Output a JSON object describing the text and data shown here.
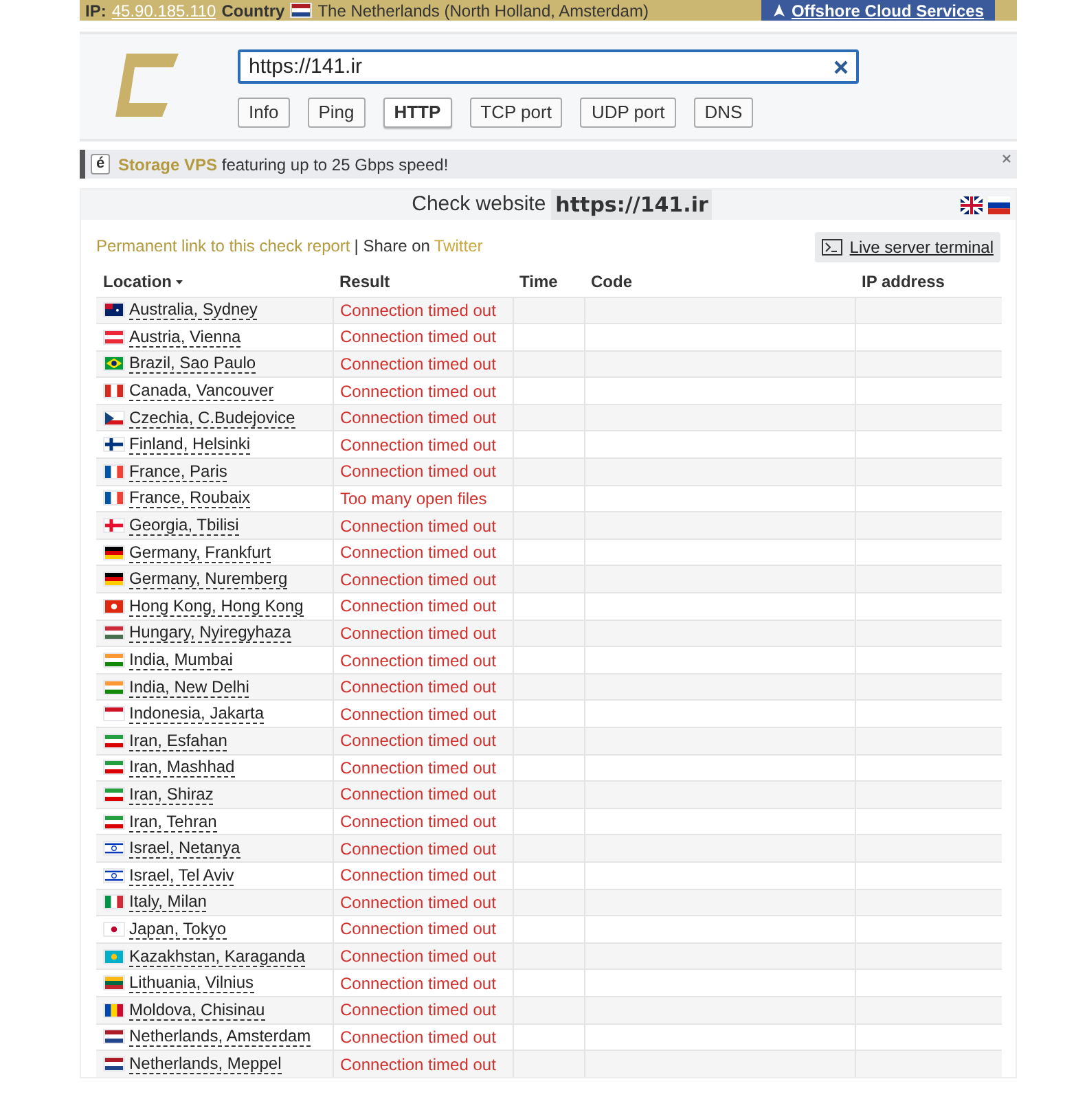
{
  "top_bar": {
    "ip_label": "IP:",
    "ip": "45.90.185.110",
    "country_label": "Country",
    "country_flag": {
      "kind": "nl"
    },
    "country": "The Netherlands (North Holland, Amsterdam)",
    "promo": "Offshore Cloud Services"
  },
  "search": {
    "value": "https://141.ir"
  },
  "tabs": [
    {
      "label": "Info",
      "selected": false
    },
    {
      "label": "Ping",
      "selected": false
    },
    {
      "label": "HTTP",
      "selected": true
    },
    {
      "label": "TCP port",
      "selected": false
    },
    {
      "label": "UDP port",
      "selected": false
    },
    {
      "label": "DNS",
      "selected": false
    }
  ],
  "banner": {
    "icon_letter": "é",
    "highlight": "Storage VPS",
    "text": "featuring up to 25 Gbps speed!"
  },
  "panel": {
    "title": "Check website",
    "target": "https://141.ir",
    "permalink": "Permanent link to this check report",
    "share_prefix": "| Share on",
    "share_link": "Twitter",
    "terminal_button": "Live server terminal"
  },
  "table": {
    "columns": [
      "Location",
      "Result",
      "Time",
      "Code",
      "IP address"
    ],
    "rows": [
      {
        "kind": "au",
        "location": "Australia, Sydney",
        "result": "Connection timed out"
      },
      {
        "kind": "at",
        "location": "Austria, Vienna",
        "result": "Connection timed out"
      },
      {
        "kind": "br",
        "location": "Brazil, Sao Paulo",
        "result": "Connection timed out"
      },
      {
        "kind": "ca",
        "location": "Canada, Vancouver",
        "result": "Connection timed out"
      },
      {
        "kind": "cz",
        "location": "Czechia, C.Budejovice",
        "result": "Connection timed out"
      },
      {
        "kind": "fi",
        "location": "Finland, Helsinki",
        "result": "Connection timed out"
      },
      {
        "kind": "fr",
        "location": "France, Paris",
        "result": "Connection timed out"
      },
      {
        "kind": "fr",
        "location": "France, Roubaix",
        "result": "Too many open files"
      },
      {
        "kind": "ge",
        "location": "Georgia, Tbilisi",
        "result": "Connection timed out"
      },
      {
        "kind": "de",
        "location": "Germany, Frankfurt",
        "result": "Connection timed out"
      },
      {
        "kind": "de",
        "location": "Germany, Nuremberg",
        "result": "Connection timed out"
      },
      {
        "kind": "hk",
        "location": "Hong Kong, Hong Kong",
        "result": "Connection timed out"
      },
      {
        "kind": "hu",
        "location": "Hungary, Nyiregyhaza",
        "result": "Connection timed out"
      },
      {
        "kind": "in",
        "location": "India, Mumbai",
        "result": "Connection timed out"
      },
      {
        "kind": "in",
        "location": "India, New Delhi",
        "result": "Connection timed out"
      },
      {
        "kind": "id",
        "location": "Indonesia, Jakarta",
        "result": "Connection timed out"
      },
      {
        "kind": "ir",
        "location": "Iran, Esfahan",
        "result": "Connection timed out"
      },
      {
        "kind": "ir",
        "location": "Iran, Mashhad",
        "result": "Connection timed out"
      },
      {
        "kind": "ir",
        "location": "Iran, Shiraz",
        "result": "Connection timed out"
      },
      {
        "kind": "ir",
        "location": "Iran, Tehran",
        "result": "Connection timed out"
      },
      {
        "kind": "il",
        "location": "Israel, Netanya",
        "result": "Connection timed out"
      },
      {
        "kind": "il",
        "location": "Israel, Tel Aviv",
        "result": "Connection timed out"
      },
      {
        "kind": "it",
        "location": "Italy, Milan",
        "result": "Connection timed out"
      },
      {
        "kind": "jp",
        "location": "Japan, Tokyo",
        "result": "Connection timed out"
      },
      {
        "kind": "kz",
        "location": "Kazakhstan, Karaganda",
        "result": "Connection timed out"
      },
      {
        "kind": "lt",
        "location": "Lithuania, Vilnius",
        "result": "Connection timed out"
      },
      {
        "kind": "md",
        "location": "Moldova, Chisinau",
        "result": "Connection timed out"
      },
      {
        "kind": "nl",
        "location": "Netherlands, Amsterdam",
        "result": "Connection timed out"
      },
      {
        "kind": "nl",
        "location": "Netherlands, Meppel",
        "result": "Connection timed out"
      }
    ]
  }
}
